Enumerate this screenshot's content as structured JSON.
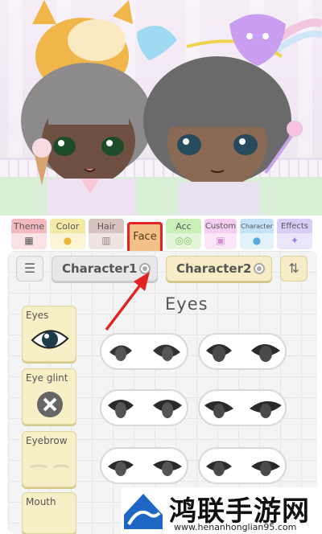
{
  "tabs": [
    {
      "label": "Theme",
      "icon": "theme-icon",
      "color": "#f3b9bf"
    },
    {
      "label": "Color",
      "icon": "paint-drop-icon",
      "color": "#f5e9a6"
    },
    {
      "label": "Hair",
      "icon": "comb-icon",
      "color": "#d8c4bf"
    },
    {
      "label": "Face",
      "icon": "face-icon",
      "color": "#f3c08a"
    },
    {
      "label": "Acc",
      "icon": "glasses-icon",
      "color": "#c8efb6"
    },
    {
      "label": "Custom",
      "icon": "picture-icon",
      "color": "#f4cdf1"
    },
    {
      "label": "Character",
      "icon": "person-icon",
      "color": "#c6e2f6"
    },
    {
      "label": "Effects",
      "icon": "sparkle-icon",
      "color": "#d8cdf6"
    }
  ],
  "character_bar": {
    "character1": "Character1",
    "character2": "Character2",
    "left_button_icon": "person-menu-icon",
    "right_button_icon": "person-swap-icon"
  },
  "section_title": "Eyes",
  "categories": [
    {
      "label": "Eyes"
    },
    {
      "label": "Eye glint"
    },
    {
      "label": "Eyebrow"
    },
    {
      "label": "Mouth"
    }
  ],
  "watermark": {
    "brand": "鸿联手游网",
    "url": "www.henanhonglian95.com"
  },
  "colors": {
    "highlight": "#e02424",
    "panel": "#f4f4f4",
    "card": "#f7efc6"
  }
}
